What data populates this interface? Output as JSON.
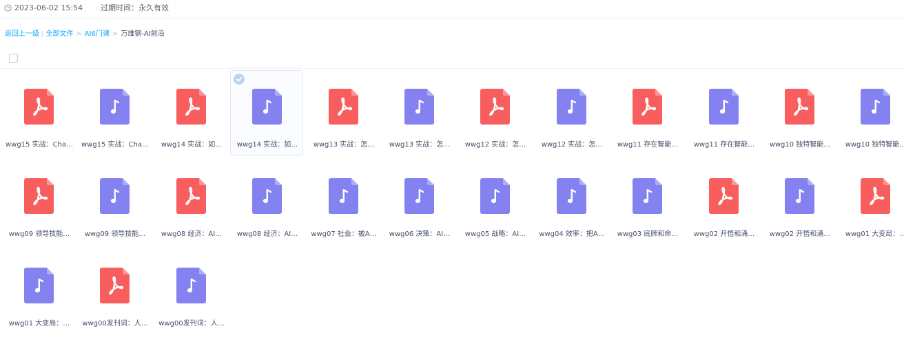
{
  "header": {
    "date": "2023-06-02 15:54",
    "expire": "过期时间：永久有效"
  },
  "breadcrumb": {
    "back": "返回上一级",
    "all": "全部文件",
    "level1": "AI6门课",
    "current": "万维钢-AI前沿"
  },
  "colors": {
    "pdf": "#f95e5f",
    "audio": "#8481f1",
    "link": "#09aaff"
  },
  "files": [
    {
      "name": "wwg15 实战：Cha…",
      "type": "pdf",
      "icon": "pdf-icon"
    },
    {
      "name": "wwg15 实战：Cha…",
      "type": "audio",
      "icon": "music-note-icon"
    },
    {
      "name": "wwg14 实战：如…",
      "type": "pdf",
      "icon": "pdf-icon"
    },
    {
      "name": "wwg14 实战：如…",
      "type": "audio",
      "icon": "music-note-icon",
      "selected": true
    },
    {
      "name": "wwg13 实战：怎…",
      "type": "pdf",
      "icon": "pdf-icon"
    },
    {
      "name": "wwg13 实战：怎…",
      "type": "audio",
      "icon": "music-note-icon"
    },
    {
      "name": "wwg12 实战：怎…",
      "type": "pdf",
      "icon": "pdf-icon"
    },
    {
      "name": "wwg12 实战：怎…",
      "type": "audio",
      "icon": "music-note-icon"
    },
    {
      "name": "wwg11 存在智能…",
      "type": "pdf",
      "icon": "pdf-icon"
    },
    {
      "name": "wwg11 存在智能…",
      "type": "audio",
      "icon": "music-note-icon"
    },
    {
      "name": "wwg10 独特智能…",
      "type": "pdf",
      "icon": "pdf-icon"
    },
    {
      "name": "wwg10 独特智能…",
      "type": "audio",
      "icon": "music-note-icon"
    },
    {
      "name": "wwg09 领导技能…",
      "type": "pdf",
      "icon": "pdf-icon"
    },
    {
      "name": "wwg09 领导技能…",
      "type": "audio",
      "icon": "music-note-icon"
    },
    {
      "name": "wwg08 经济：AI…",
      "type": "pdf",
      "icon": "pdf-icon"
    },
    {
      "name": "wwg08 经济：AI…",
      "type": "audio",
      "icon": "music-note-icon"
    },
    {
      "name": "wwg07 社会：被A…",
      "type": "audio",
      "icon": "music-note-icon"
    },
    {
      "name": "wwg06 决策：AI…",
      "type": "audio",
      "icon": "music-note-icon"
    },
    {
      "name": "wwg05 战略：AI…",
      "type": "audio",
      "icon": "music-note-icon"
    },
    {
      "name": "wwg04 效率：把A…",
      "type": "audio",
      "icon": "music-note-icon"
    },
    {
      "name": "wwg03 底牌和命…",
      "type": "audio",
      "icon": "music-note-icon"
    },
    {
      "name": "wwg02 开悟和涌…",
      "type": "pdf",
      "icon": "pdf-icon"
    },
    {
      "name": "wwg02 开悟和涌…",
      "type": "audio",
      "icon": "music-note-icon"
    },
    {
      "name": "wwg01 大变局：…",
      "type": "pdf",
      "icon": "pdf-icon"
    },
    {
      "name": "wwg01 大变局：…",
      "type": "audio",
      "icon": "music-note-icon"
    },
    {
      "name": "wwg00发刊词：人…",
      "type": "pdf",
      "icon": "pdf-icon"
    },
    {
      "name": "wwg00发刊词：人…",
      "type": "audio",
      "icon": "music-note-icon"
    }
  ]
}
